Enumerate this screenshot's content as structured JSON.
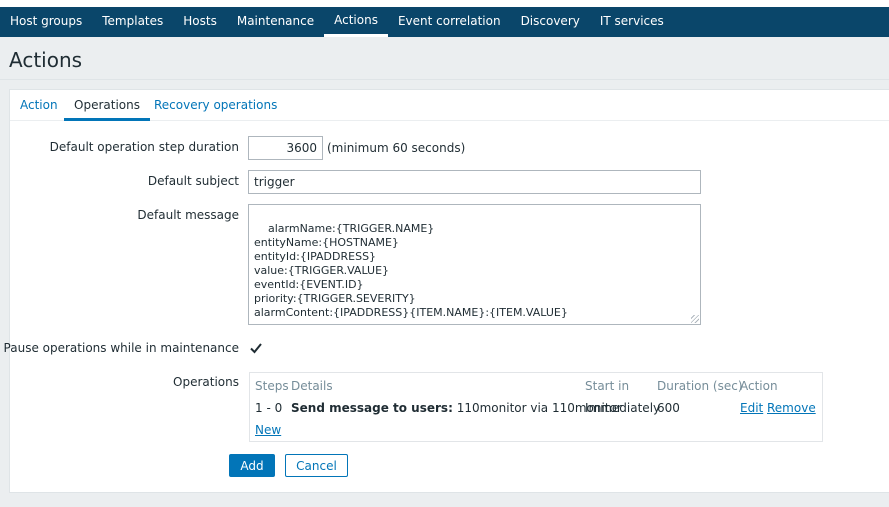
{
  "nav": {
    "items": [
      {
        "label": "Host groups"
      },
      {
        "label": "Templates"
      },
      {
        "label": "Hosts"
      },
      {
        "label": "Maintenance"
      },
      {
        "label": "Actions"
      },
      {
        "label": "Event correlation"
      },
      {
        "label": "Discovery"
      },
      {
        "label": "IT services"
      }
    ],
    "active": "Actions"
  },
  "page": {
    "title": "Actions"
  },
  "tabs": [
    {
      "label": "Action"
    },
    {
      "label": "Operations"
    },
    {
      "label": "Recovery operations"
    }
  ],
  "form": {
    "step_duration_label": "Default operation step duration",
    "step_duration_value": "3600",
    "step_duration_hint": "(minimum 60 seconds)",
    "subject_label": "Default subject",
    "subject_value": "trigger",
    "message_label": "Default message",
    "message_value": "alarmName:{TRIGGER.NAME}\nentityName:{HOSTNAME}\nentityId:{IPADDRESS}\nvalue:{TRIGGER.VALUE}\neventId:{EVENT.ID}\npriority:{TRIGGER.SEVERITY}\nalarmContent:{IPADDRESS}{ITEM.NAME}:{ITEM.VALUE}",
    "pause_label": "Pause operations while in maintenance",
    "pause_checked": true,
    "operations_label": "Operations"
  },
  "operations": {
    "headers": {
      "steps": "Steps",
      "details": "Details",
      "start_in": "Start in",
      "duration": "Duration (sec)",
      "action": "Action"
    },
    "rows": [
      {
        "steps": "1 - 0",
        "details_bold": "Send message to users:",
        "details_rest": " 110monitor via 110monitor",
        "start_in": "Immediately",
        "duration": "600",
        "edit": "Edit",
        "remove": "Remove"
      }
    ],
    "new_link": "New"
  },
  "buttons": {
    "add": "Add",
    "cancel": "Cancel"
  },
  "colors": {
    "header_bg": "#0a466a",
    "accent": "#0275b8",
    "page_bg": "#ebeef0"
  }
}
